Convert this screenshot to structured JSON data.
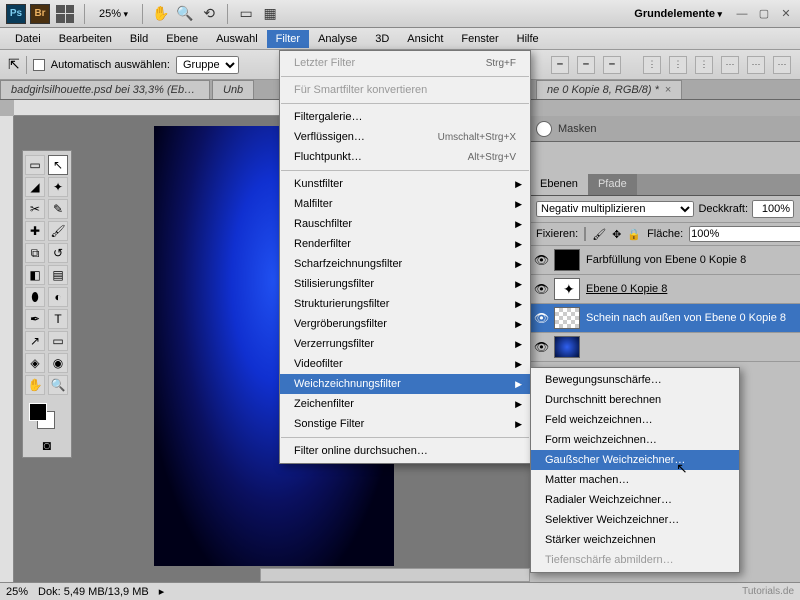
{
  "titlebar": {
    "ps": "Ps",
    "br": "Br",
    "zoom": "25%",
    "workspace": "Grundelemente"
  },
  "menubar": [
    "Datei",
    "Bearbeiten",
    "Bild",
    "Ebene",
    "Auswahl",
    "Filter",
    "Analyse",
    "3D",
    "Ansicht",
    "Fenster",
    "Hilfe"
  ],
  "optbar": {
    "auto": "Automatisch auswählen:",
    "group": "Gruppe"
  },
  "tabs": [
    "badgirlsilhouette.psd bei 33,3% (Ebe…",
    "Unb",
    "ne 0 Kopie 8, RGB/8) *"
  ],
  "filterMenu": {
    "last": "Letzter Filter",
    "lastShortcut": "Strg+F",
    "smart": "Für Smartfilter konvertieren",
    "gallery": "Filtergalerie…",
    "liquify": "Verflüssigen…",
    "liquifyShortcut": "Umschalt+Strg+X",
    "vanish": "Fluchtpunkt…",
    "vanishShortcut": "Alt+Strg+V",
    "groups": [
      "Kunstfilter",
      "Malfilter",
      "Rauschfilter",
      "Renderfilter",
      "Scharfzeichnungsfilter",
      "Stilisierungsfilter",
      "Strukturierungsfilter",
      "Vergröberungsfilter",
      "Verzerrungsfilter",
      "Videofilter",
      "Weichzeichnungsfilter",
      "Zeichenfilter",
      "Sonstige Filter"
    ],
    "online": "Filter online durchsuchen…"
  },
  "blurSubmenu": [
    "Bewegungsunschärfe…",
    "Durchschnitt berechnen",
    "Feld weichzeichnen…",
    "Form weichzeichnen…",
    "Gaußscher Weichzeichner…",
    "Matter machen…",
    "Radialer Weichzeichner…",
    "Selektiver Weichzeichner…",
    "Stärker weichzeichnen",
    "Tiefenschärfe abmildern…"
  ],
  "panels": {
    "masken": "Masken",
    "tabs": [
      "Ebenen",
      "Pfade"
    ],
    "blend": "Negativ multiplizieren",
    "opacityLabel": "Deckkraft:",
    "opacity": "100%",
    "lock": "Fixieren:",
    "fillLabel": "Fläche:",
    "fill": "100%"
  },
  "layers": [
    {
      "name": "Farbfüllung von Ebene 0 Kopie 8"
    },
    {
      "name": "Ebene 0 Kopie 8"
    },
    {
      "name": "Schein nach außen von Ebene 0 Kopie 8"
    }
  ],
  "status": {
    "zoom": "25%",
    "doc": "Dok: 5,49 MB/13,9 MB",
    "watermark": "Tutorials.de"
  }
}
